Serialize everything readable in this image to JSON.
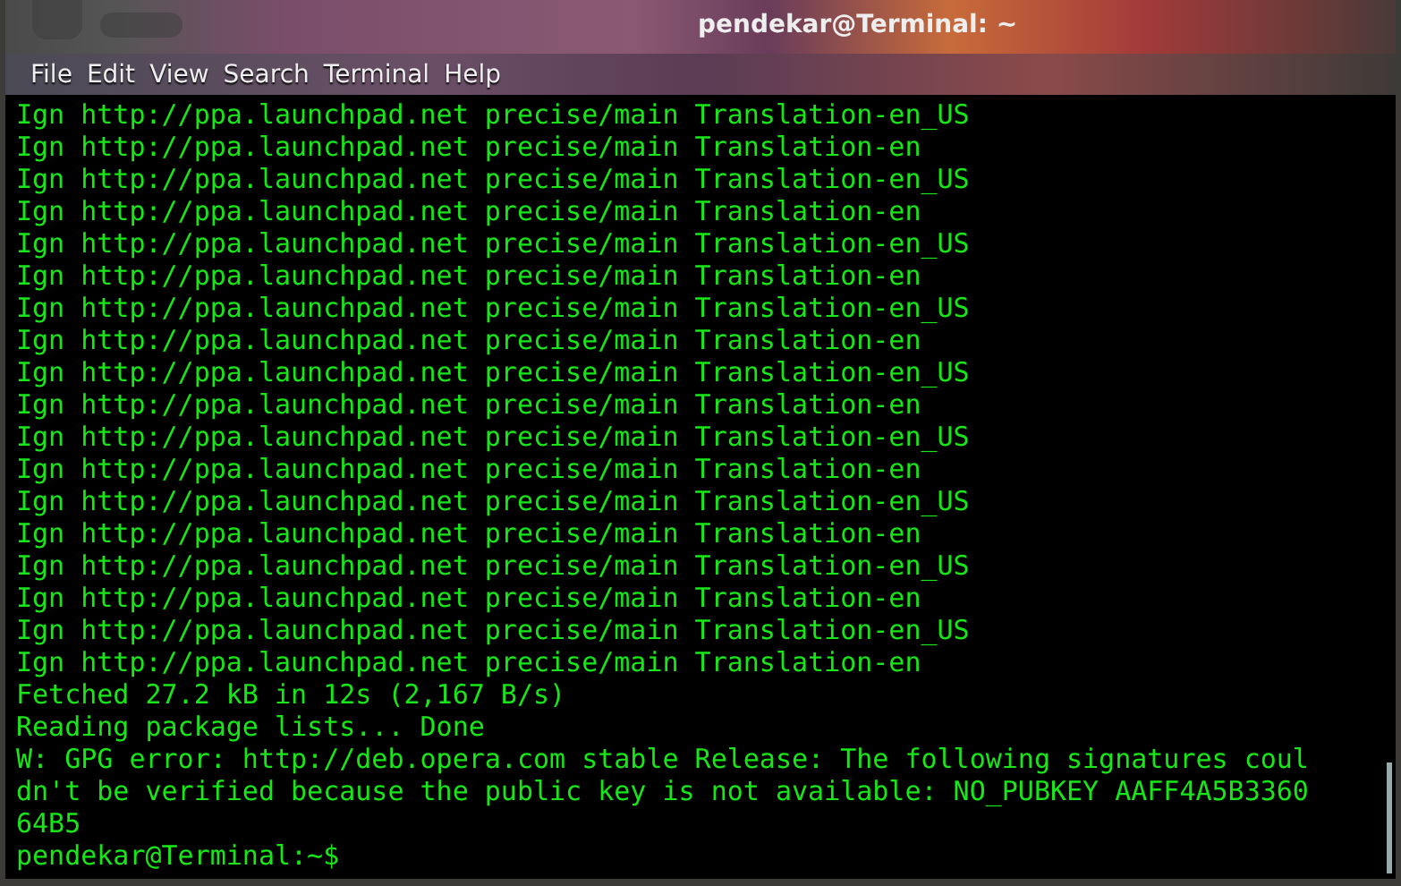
{
  "window": {
    "title": "pendekar@Terminal: ~"
  },
  "menu": [
    "File",
    "Edit",
    "View",
    "Search",
    "Terminal",
    "Help"
  ],
  "terminal": {
    "lines": [
      "Ign http://ppa.launchpad.net precise/main Translation-en_US",
      "Ign http://ppa.launchpad.net precise/main Translation-en",
      "Ign http://ppa.launchpad.net precise/main Translation-en_US",
      "Ign http://ppa.launchpad.net precise/main Translation-en",
      "Ign http://ppa.launchpad.net precise/main Translation-en_US",
      "Ign http://ppa.launchpad.net precise/main Translation-en",
      "Ign http://ppa.launchpad.net precise/main Translation-en_US",
      "Ign http://ppa.launchpad.net precise/main Translation-en",
      "Ign http://ppa.launchpad.net precise/main Translation-en_US",
      "Ign http://ppa.launchpad.net precise/main Translation-en",
      "Ign http://ppa.launchpad.net precise/main Translation-en_US",
      "Ign http://ppa.launchpad.net precise/main Translation-en",
      "Ign http://ppa.launchpad.net precise/main Translation-en_US",
      "Ign http://ppa.launchpad.net precise/main Translation-en",
      "Ign http://ppa.launchpad.net precise/main Translation-en_US",
      "Ign http://ppa.launchpad.net precise/main Translation-en",
      "Ign http://ppa.launchpad.net precise/main Translation-en_US",
      "Ign http://ppa.launchpad.net precise/main Translation-en",
      "Fetched 27.2 kB in 12s (2,167 B/s)",
      "Reading package lists... Done",
      "W: GPG error: http://deb.opera.com stable Release: The following signatures coul",
      "dn't be verified because the public key is not available: NO_PUBKEY AAFF4A5B3360",
      "64B5",
      "pendekar@Terminal:~$"
    ]
  }
}
